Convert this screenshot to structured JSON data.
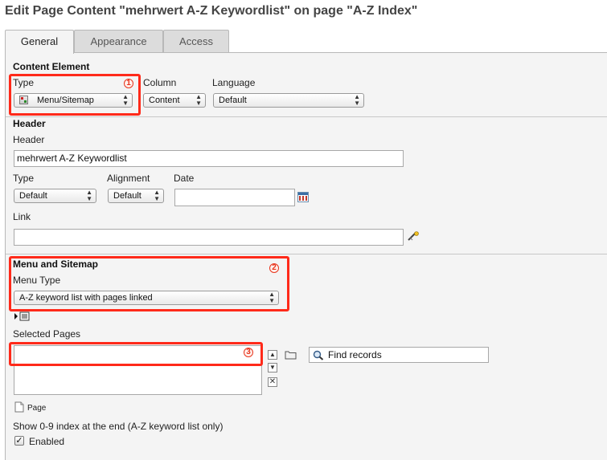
{
  "page_title": "Edit Page Content \"mehrwert A-Z Keywordlist\" on page \"A-Z Index\"",
  "tabs": [
    {
      "label": "General",
      "active": true
    },
    {
      "label": "Appearance",
      "active": false
    },
    {
      "label": "Access",
      "active": false
    }
  ],
  "content_element": {
    "section_title": "Content Element",
    "type_label": "Type",
    "type_value": "Menu/Sitemap",
    "column_label": "Column",
    "column_value": "Content",
    "language_label": "Language",
    "language_value": "Default"
  },
  "header": {
    "section_title": "Header",
    "header_label": "Header",
    "header_value": "mehrwert A-Z Keywordlist",
    "type_label": "Type",
    "type_value": "Default",
    "alignment_label": "Alignment",
    "alignment_value": "Default",
    "date_label": "Date",
    "date_value": "",
    "link_label": "Link",
    "link_value": ""
  },
  "menu": {
    "section_title": "Menu and Sitemap",
    "menu_type_label": "Menu Type",
    "menu_type_value": "A-Z keyword list with pages linked",
    "selected_pages_label": "Selected Pages",
    "selected_pages_value": "",
    "find_records_label": "Find records",
    "page_label": "Page",
    "index_label": "Show 0-9 index at the end (A-Z keyword list only)",
    "enabled_label": "Enabled",
    "enabled_checked": true
  },
  "annotations": [
    "1",
    "2",
    "3"
  ],
  "colors": {
    "annotation": "#ff2a1a",
    "panel_bg": "#f4f4f4"
  }
}
